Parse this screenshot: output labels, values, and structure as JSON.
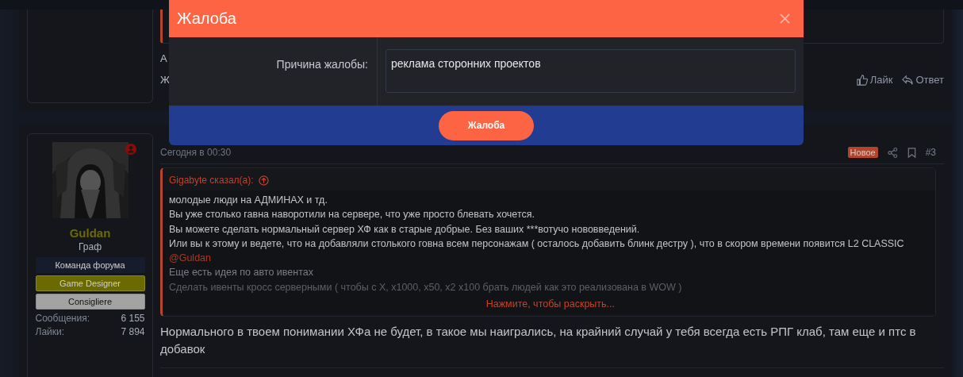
{
  "modal": {
    "title": "Жалоба",
    "field_label": "Причина жалобы:",
    "field_value": "реклама сторонних проектов",
    "submit": "Жалоба"
  },
  "previous_post": {
    "text_lines": [
      "А",
      "Ж"
    ],
    "actions": [
      {
        "label": "Лайк",
        "kind": "like"
      },
      {
        "label": "Ответ",
        "kind": "reply"
      }
    ]
  },
  "post": {
    "user": {
      "name": "Guldan",
      "title": "Граф",
      "banners": [
        {
          "label": "Команда форума",
          "color": "#161c2b"
        },
        {
          "label": "Game Designer",
          "color": "#6b6a00"
        },
        {
          "label": "Consigliere",
          "color": "#a3a3a3"
        }
      ],
      "stats": [
        {
          "label": "Сообщения:",
          "value": "6 155"
        },
        {
          "label": "Лайки:",
          "value": "7 894"
        }
      ]
    },
    "time": "Сегодня в 00:30",
    "badge": "Новое",
    "number": "#3",
    "quote": {
      "author": "Gigabyte сказал(а):",
      "lines": [
        {
          "kind": "text",
          "text": "молодые люди на АДМИНАХ и тд."
        },
        {
          "kind": "text",
          "text": "Вы уже столько гавна наворотили на сервере, что уже просто блевать хочется."
        },
        {
          "kind": "text",
          "text": "Вы можете сделать нормальный сервер ХФ как в старые добрые. Без ваших ***вотучо нововведений."
        },
        {
          "kind": "text",
          "text": "Или вы к этому и ведете, что на добавляли столького говна всем персонажам ( осталось добавить блинк дестру ), что в скором времени появится L2 CLASSIC"
        },
        {
          "kind": "mention",
          "text": "@Guldan"
        },
        {
          "kind": "faded",
          "text": "Еще есть идея по авто ивентах"
        },
        {
          "kind": "hidden",
          "text": "Сделать ивенты кросс серверными ( чтобы с Х, x1000, x50, x2 x100 брать людей как это реализована в WOW )"
        }
      ],
      "expand": "Нажмите, чтобы раскрыть..."
    },
    "text": "Нормального в твоем понимании ХФа не будет, в такое мы наигрались, на крайний случай у тебя всегда есть РПГ клаб, там еще и птс в добавок"
  }
}
